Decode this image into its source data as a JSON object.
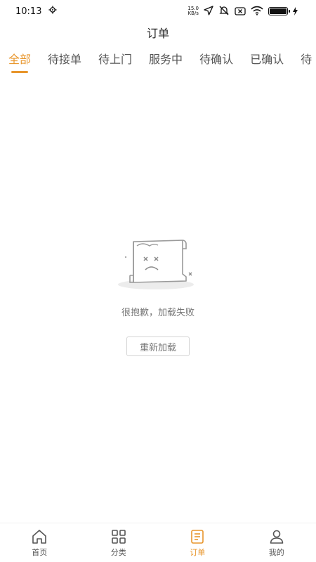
{
  "status_bar": {
    "time": "10:13",
    "speed_value": "15.0",
    "speed_unit": "KB/s"
  },
  "header": {
    "title": "订单"
  },
  "tabs": [
    {
      "label": "全部",
      "active": true
    },
    {
      "label": "待接单"
    },
    {
      "label": "待上门"
    },
    {
      "label": "服务中"
    },
    {
      "label": "待确认"
    },
    {
      "label": "已确认"
    },
    {
      "label": "待"
    }
  ],
  "empty_state": {
    "message": "很抱歉，加载失败",
    "reload_label": "重新加载"
  },
  "bottom_nav": [
    {
      "label": "首页",
      "icon": "home-icon"
    },
    {
      "label": "分类",
      "icon": "grid-icon"
    },
    {
      "label": "订单",
      "icon": "order-icon",
      "active": true
    },
    {
      "label": "我的",
      "icon": "user-icon"
    }
  ],
  "colors": {
    "accent": "#e8962c"
  }
}
